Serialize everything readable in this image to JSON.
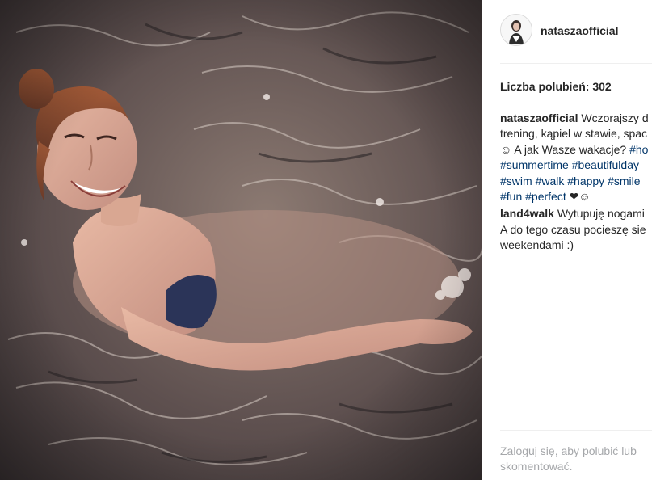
{
  "post": {
    "image_alt": "",
    "author": "nataszaofficial",
    "likes_text": "Liczba polubień: 302",
    "caption": {
      "user": "nataszaofficial",
      "text_lines": [
        "Wczorajszy d",
        "trening, kąpiel w stawie, spac",
        "☺ A jak Wasze wakacje? "
      ],
      "tags_line1": [
        "#ho"
      ],
      "tags_line2": [
        "#summertime",
        "#beautifulday"
      ],
      "tags_line3": [
        "#swim",
        "#walk",
        "#happy",
        "#smile"
      ],
      "tags_line4": [
        "#fun",
        "#perfect"
      ],
      "tail_emoji": "❤☺"
    },
    "comments": [
      {
        "user": "land4walk",
        "text": "Wytupuję nogami",
        "lines": [
          "A do tego czasu pocieszę sie",
          "weekendami :)"
        ]
      }
    ],
    "login_prompt": {
      "link": "Zaloguj się",
      "rest": ", aby polubić lub skomentować."
    }
  }
}
